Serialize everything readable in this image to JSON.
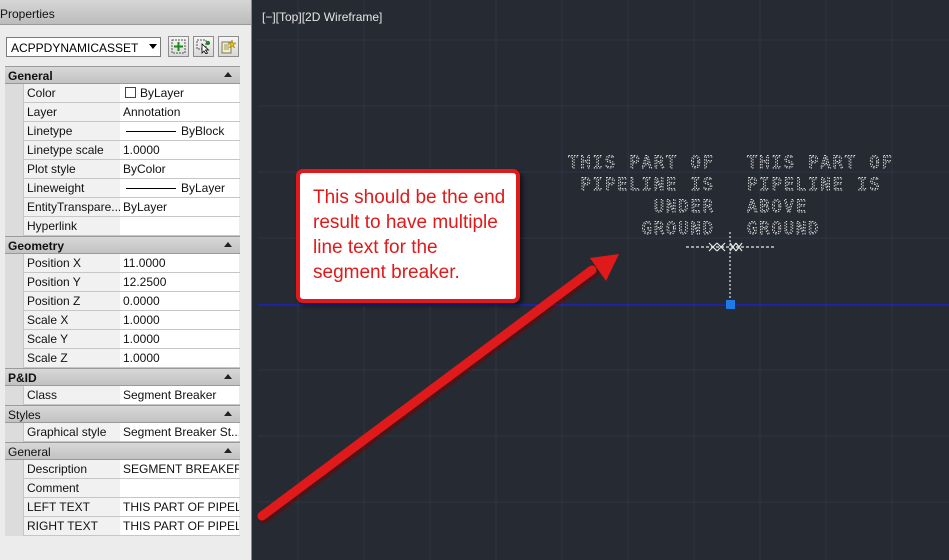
{
  "panel": {
    "title": "Properties",
    "object_type": "ACPPDYNAMICASSET"
  },
  "toolbar": {
    "buttons": [
      {
        "icon": "toggle-pickadd-icon"
      },
      {
        "icon": "select-objects-icon"
      },
      {
        "icon": "quick-select-icon"
      }
    ]
  },
  "sections": {
    "general": {
      "label": "General",
      "rows": [
        {
          "name": "Color",
          "value": "ByLayer"
        },
        {
          "name": "Layer",
          "value": "Annotation"
        },
        {
          "name": "Linetype",
          "value": "ByBlock"
        },
        {
          "name": "Linetype scale",
          "value": "1.0000"
        },
        {
          "name": "Plot style",
          "value": "ByColor"
        },
        {
          "name": "Lineweight",
          "value": "ByLayer"
        },
        {
          "name": "EntityTranspare...",
          "value": "ByLayer"
        },
        {
          "name": "Hyperlink",
          "value": ""
        }
      ]
    },
    "geometry": {
      "label": "Geometry",
      "rows": [
        {
          "name": "Position X",
          "value": "11.0000"
        },
        {
          "name": "Position Y",
          "value": "12.2500"
        },
        {
          "name": "Position Z",
          "value": "0.0000"
        },
        {
          "name": "Scale X",
          "value": "1.0000"
        },
        {
          "name": "Scale Y",
          "value": "1.0000"
        },
        {
          "name": "Scale Z",
          "value": "1.0000"
        }
      ]
    },
    "pid": {
      "label": "P&ID",
      "rows": [
        {
          "name": "Class",
          "value": "Segment Breaker"
        }
      ]
    },
    "styles": {
      "label": "Styles",
      "rows": [
        {
          "name": "Graphical style",
          "value": "Segment Breaker St..."
        }
      ]
    },
    "general2": {
      "label": "General",
      "rows": [
        {
          "name": "Description",
          "value": "SEGMENT BREAKER"
        },
        {
          "name": "Comment",
          "value": ""
        },
        {
          "name": "LEFT TEXT",
          "value": "THIS PART OF PIPEL..."
        },
        {
          "name": "RIGHT TEXT",
          "value": "THIS PART OF PIPEL..."
        }
      ]
    }
  },
  "viewport": {
    "label": "[−][Top][2D Wireframe]",
    "left_text": [
      "THIS PART OF",
      "PIPELINE IS",
      "UNDER",
      "GROUND"
    ],
    "right_text": [
      "THIS PART OF",
      "PIPELINE IS",
      "ABOVE",
      "GROUND"
    ]
  },
  "callout": {
    "text": "This should be the end result to have multiple line text for the segment breaker."
  },
  "colors": {
    "canvas_bg": "#252a33",
    "grid_line": "#303743",
    "pipe_line": "#1a22c8",
    "grip": "#1e7be6",
    "callout_red": "#e01a1a"
  }
}
